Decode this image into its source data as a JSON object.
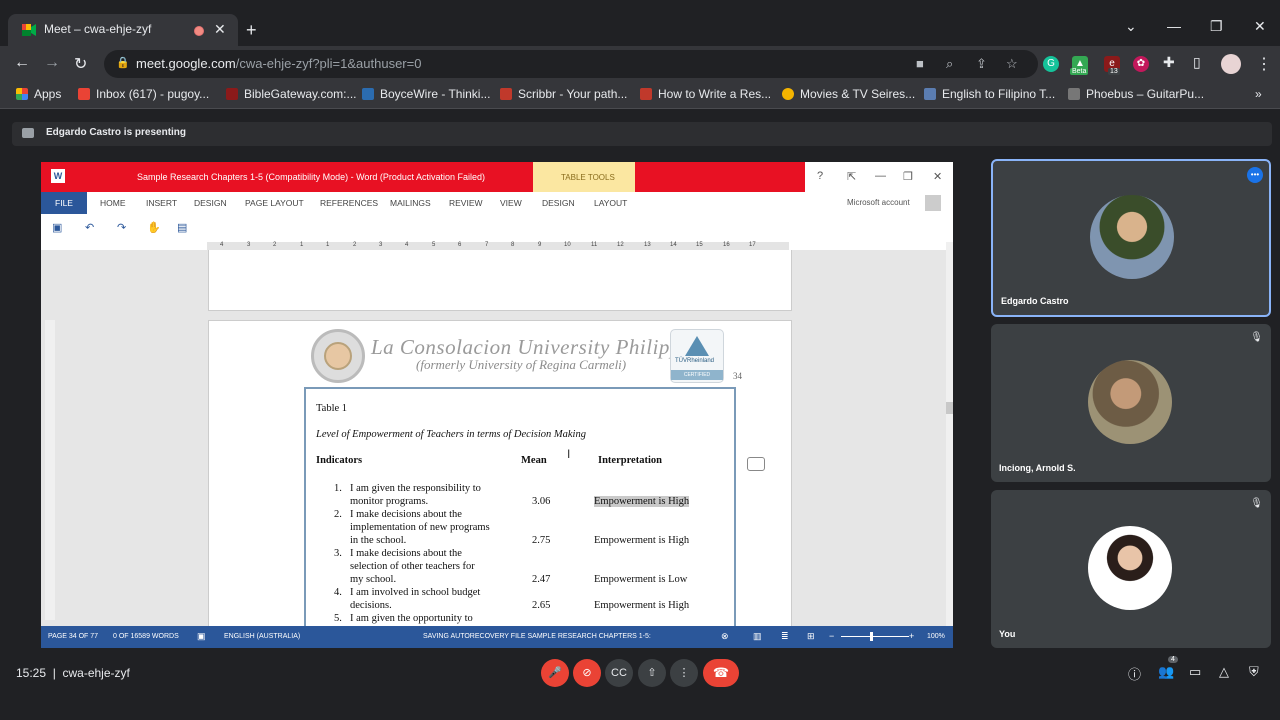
{
  "browser": {
    "tab_title": "Meet – cwa-ehje-zyf",
    "tab_close": "✕",
    "new_tab": "+",
    "window_controls": [
      "⌄",
      "—",
      "❐",
      "✕"
    ],
    "url_host": "meet.google.com",
    "url_path": "/cwa-ehje-zyf?pli=1&authuser=0",
    "ext_badge_beta": "Beta",
    "ext_badge_count": "13",
    "bookmarks": [
      {
        "label": "Apps",
        "color": "#4285f4"
      },
      {
        "label": "Inbox (617) - pugoy...",
        "color": "#ea4335"
      },
      {
        "label": "BibleGateway.com:...",
        "color": "#8b1a1a"
      },
      {
        "label": "BoyceWire - Thinki...",
        "color": "#2b6cb0"
      },
      {
        "label": "Scribbr - Your path...",
        "color": "#c0392b"
      },
      {
        "label": "How to Write a Res...",
        "color": "#c0392b"
      },
      {
        "label": "Movies & TV Seires...",
        "color": "#f4b400"
      },
      {
        "label": "English to Filipino T...",
        "color": "#5b7db1"
      },
      {
        "label": "Phoebus – GuitarPu...",
        "color": "#777777"
      }
    ],
    "bookmarks_more": "»"
  },
  "meet": {
    "presenting_text": "Edgardo Castro is presenting",
    "clock": "15:25",
    "meeting_code": "cwa-ehje-zyf",
    "participants_count": "4",
    "participants": [
      {
        "name": "Edgardo Castro",
        "speaking": true,
        "avatar_color": "#6b7f95"
      },
      {
        "name": "Inciong, Arnold S.",
        "muted": true,
        "avatar_color": "#8a7a62"
      },
      {
        "name": "You",
        "muted": true,
        "avatar_color": "#f2eeee"
      }
    ]
  },
  "word": {
    "title": "Sample Research Chapters 1-5 (Compatibility Mode) - Word (Product Activation Failed)",
    "table_tools": "TABLE TOOLS",
    "ribbon_tabs": [
      "FILE",
      "HOME",
      "INSERT",
      "DESIGN",
      "PAGE LAYOUT",
      "REFERENCES",
      "MAILINGS",
      "REVIEW",
      "VIEW",
      "DESIGN",
      "LAYOUT"
    ],
    "account": "Microsoft account",
    "ruler_numbers": [
      "4",
      "3",
      "2",
      "1",
      "1",
      "2",
      "3",
      "4",
      "5",
      "6",
      "7",
      "8",
      "9",
      "10",
      "11",
      "12",
      "13",
      "14",
      "15",
      "16",
      "17"
    ],
    "status": {
      "page": "PAGE 34 OF 77",
      "words": "0 OF 16589 WORDS",
      "language": "ENGLISH (AUSTRALIA)",
      "saving": "SAVING AUTORECOVERY FILE SAMPLE RESEARCH CHAPTERS 1-5:",
      "zoom": "100%"
    },
    "letterhead": {
      "line1": "La Consolacion University Philippines",
      "line2": "(formerly University of Regina Carmeli)",
      "tuv_text": "TÜVRheinland",
      "tuv_cert": "CERTIFIED"
    },
    "page_number": "34",
    "doc": {
      "table_label": "Table 1",
      "table_caption": "Level of Empowerment of Teachers in terms of Decision Making",
      "headers": [
        "Indicators",
        "Mean",
        "Interpretation"
      ],
      "rows": [
        {
          "num": "1.",
          "lines": [
            "I am given the responsibility to",
            "monitor programs."
          ],
          "mean": "3.06",
          "interp": "Empowerment is High"
        },
        {
          "num": "2.",
          "lines": [
            "I make decisions about the",
            "implementation of new programs",
            "in the school."
          ],
          "mean": "2.75",
          "interp": "Empowerment is High"
        },
        {
          "num": "3.",
          "lines": [
            "I make decisions about the",
            "selection of other teachers for",
            "my school."
          ],
          "mean": "2.47",
          "interp": "Empowerment is Low"
        },
        {
          "num": "4.",
          "lines": [
            "I am involved in school budget",
            "decisions."
          ],
          "mean": "2.65",
          "interp": "Empowerment is High"
        },
        {
          "num": "5.",
          "lines": [
            "I am given the opportunity to"
          ],
          "mean": "",
          "interp": ""
        }
      ]
    }
  }
}
